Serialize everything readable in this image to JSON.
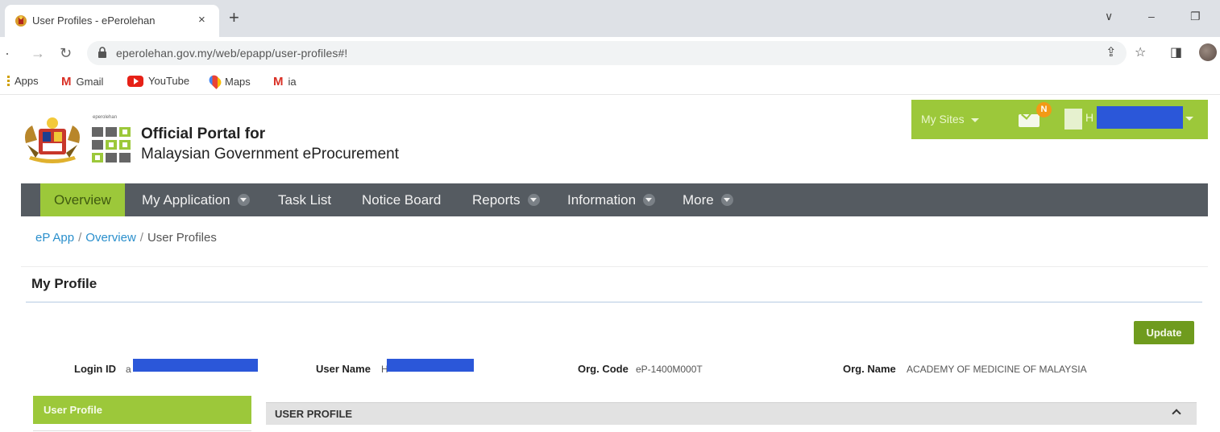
{
  "browser": {
    "tab_title": "User Profiles - ePerolehan",
    "tab_close": "×",
    "new_tab": "+",
    "window_controls": {
      "tabsearch": "∨",
      "minimize": "–",
      "restore": "❐"
    },
    "url": "eperolehan.gov.my/web/epapp/user-profiles#!",
    "bookmarks": {
      "apps": "Apps",
      "gmail": "Gmail",
      "youtube": "YouTube",
      "maps": "Maps",
      "ia": "ia"
    }
  },
  "header": {
    "brand_small": "eperolehan",
    "title": "Official Portal for",
    "subtitle": "Malaysian Government eProcurement",
    "my_sites": "My Sites",
    "notification_badge": "N",
    "user_initial": "H"
  },
  "nav": {
    "items": [
      {
        "label": "Overview",
        "active": true,
        "dropdown": false
      },
      {
        "label": "My Application",
        "active": false,
        "dropdown": true
      },
      {
        "label": "Task List",
        "active": false,
        "dropdown": false
      },
      {
        "label": "Notice Board",
        "active": false,
        "dropdown": false
      },
      {
        "label": "Reports",
        "active": false,
        "dropdown": true
      },
      {
        "label": "Information",
        "active": false,
        "dropdown": true
      },
      {
        "label": "More",
        "active": false,
        "dropdown": true
      }
    ]
  },
  "breadcrumb": {
    "root": "eP App",
    "sep": "/",
    "overview": "Overview",
    "current": "User Profiles"
  },
  "page": {
    "title": "My Profile",
    "update_label": "Update",
    "fields": {
      "login_id_label": "Login ID",
      "login_id_value": "a",
      "user_name_label": "User Name",
      "user_name_value": "H",
      "org_code_label": "Org. Code",
      "org_code_value": "eP-1400M000T",
      "org_name_label": "Org. Name",
      "org_name_value": "ACADEMY OF MEDICINE OF MALAYSIA"
    },
    "side_menu_active": "User Profile",
    "panel_title": "USER PROFILE"
  },
  "colors": {
    "accent_green": "#9cc83a",
    "button_green": "#6f9b1e",
    "nav_gray": "#555b61",
    "redaction_blue": "#2b57d9",
    "link_blue": "#2a8fcc"
  }
}
